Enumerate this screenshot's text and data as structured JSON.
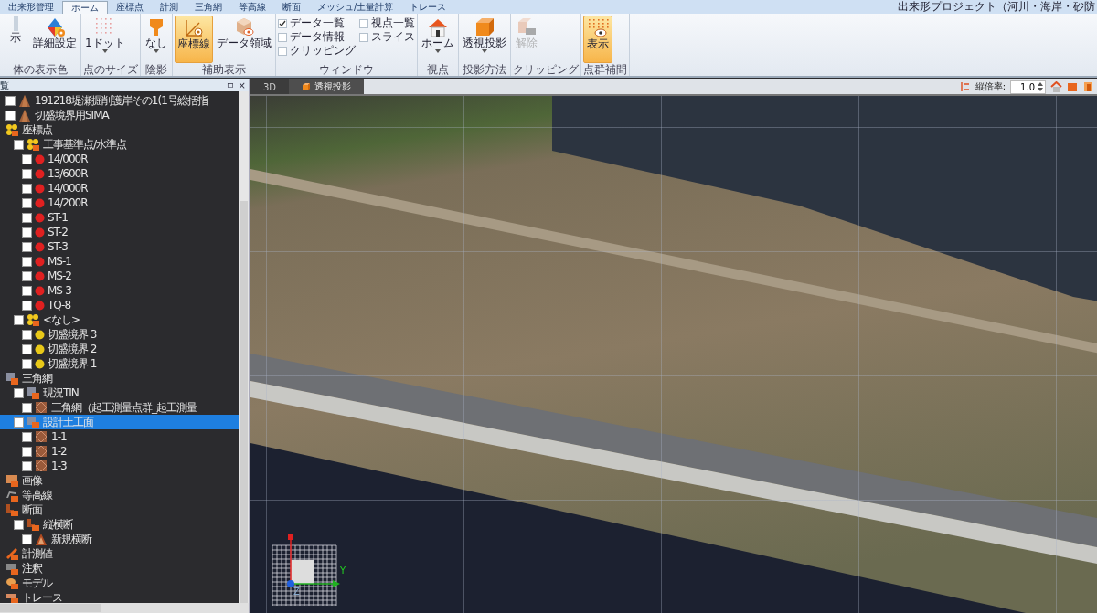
{
  "menu_tabs": [
    {
      "label": "出来形管理",
      "selected": false
    },
    {
      "label": "ホーム",
      "selected": true
    },
    {
      "label": "座標点",
      "selected": false
    },
    {
      "label": "計測",
      "selected": false
    },
    {
      "label": "三角網",
      "selected": false
    },
    {
      "label": "等高線",
      "selected": false
    },
    {
      "label": "断面",
      "selected": false
    },
    {
      "label": "メッシュ/土量計算",
      "selected": false
    },
    {
      "label": "トレース",
      "selected": false
    }
  ],
  "window": {
    "title": "出来形プロジェクト（河川・海岸・砂防"
  },
  "ribbon": [
    {
      "label": "体の表示色",
      "items": [
        {
          "kind": "display",
          "label": "示",
          "active": false,
          "disabled": false,
          "dropdown": false
        },
        {
          "kind": "settings",
          "label": "詳細設定",
          "active": false,
          "disabled": false,
          "dropdown": false
        }
      ]
    },
    {
      "label": "点のサイズ",
      "items": [
        {
          "kind": "pointsize",
          "label": "1ドット",
          "active": false,
          "disabled": false,
          "dropdown": true
        }
      ]
    },
    {
      "label": "陰影",
      "items": [
        {
          "kind": "shading",
          "label": "なし",
          "active": false,
          "disabled": false,
          "dropdown": true
        }
      ]
    },
    {
      "label": "補助表示",
      "items": [
        {
          "kind": "axes",
          "label": "座標線",
          "active": true,
          "disabled": false,
          "dropdown": false
        },
        {
          "kind": "dataarea",
          "label": "データ領域",
          "active": false,
          "disabled": false,
          "dropdown": false
        }
      ]
    },
    {
      "label": "ウィンドウ",
      "items": [
        {
          "kind": "checks",
          "checks": [
            {
              "label": "データ一覧",
              "checked": true
            },
            {
              "label": "視点一覧",
              "checked": false
            },
            {
              "label": "データ情報",
              "checked": false
            },
            {
              "label": "スライス",
              "checked": false
            },
            {
              "label": "クリッピング",
              "checked": false
            }
          ]
        }
      ]
    },
    {
      "label": "視点",
      "items": [
        {
          "kind": "home",
          "label": "ホーム",
          "active": false,
          "disabled": false,
          "dropdown": true
        }
      ]
    },
    {
      "label": "投影方法",
      "items": [
        {
          "kind": "projection",
          "label": "透視投影",
          "active": false,
          "disabled": false,
          "dropdown": true
        }
      ]
    },
    {
      "label": "クリッピング",
      "items": [
        {
          "kind": "clip",
          "label": "解除",
          "active": false,
          "disabled": true,
          "dropdown": false
        }
      ]
    },
    {
      "label": "点群補間",
      "items": [
        {
          "kind": "interpolate",
          "label": "表示",
          "active": true,
          "disabled": false,
          "dropdown": false
        }
      ]
    }
  ],
  "panel": {
    "title": "覧",
    "pin": "ㅁ",
    "close": "×"
  },
  "tree": [
    {
      "label": "191218堤瀬掘削護岸その1(1号総括指",
      "kind": "pointcloud",
      "checked": false,
      "selected": false
    },
    {
      "label": "切盛境界用SIMA",
      "kind": "pointcloud",
      "checked": false,
      "selected": false
    },
    {
      "label": "座標点",
      "kind": "points-group",
      "selected": false,
      "children": [
        {
          "label": "工事基準点/水準点",
          "kind": "points-group",
          "checked": false,
          "selected": false,
          "children": [
            {
              "label": "14/000R",
              "kind": "point",
              "color": "#e02020",
              "checked": false,
              "selected": false
            },
            {
              "label": "13/600R",
              "kind": "point",
              "color": "#e02020",
              "checked": false,
              "selected": false
            },
            {
              "label": "14/000R",
              "kind": "point",
              "color": "#e02020",
              "checked": false,
              "selected": false
            },
            {
              "label": "14/200R",
              "kind": "point",
              "color": "#e02020",
              "checked": false,
              "selected": false
            },
            {
              "label": "ST-1",
              "kind": "point",
              "color": "#e02020",
              "checked": false,
              "selected": false
            },
            {
              "label": "ST-2",
              "kind": "point",
              "color": "#e02020",
              "checked": false,
              "selected": false
            },
            {
              "label": "ST-3",
              "kind": "point",
              "color": "#e02020",
              "checked": false,
              "selected": false
            },
            {
              "label": "MS-1",
              "kind": "point",
              "color": "#e02020",
              "checked": false,
              "selected": false
            },
            {
              "label": "MS-2",
              "kind": "point",
              "color": "#e02020",
              "checked": false,
              "selected": false
            },
            {
              "label": "MS-3",
              "kind": "point",
              "color": "#e02020",
              "checked": false,
              "selected": false
            },
            {
              "label": "TQ-8",
              "kind": "point",
              "color": "#e02020",
              "checked": false,
              "selected": false
            }
          ]
        },
        {
          "label": "<なし>",
          "kind": "points-group",
          "checked": false,
          "selected": false,
          "children": [
            {
              "label": "切盛境界 3",
              "kind": "point",
              "color": "#e8c818",
              "checked": false,
              "selected": false
            },
            {
              "label": "切盛境界 2",
              "kind": "point",
              "color": "#e8c818",
              "checked": false,
              "selected": false
            },
            {
              "label": "切盛境界 1",
              "kind": "point",
              "color": "#e8c818",
              "checked": false,
              "selected": false
            }
          ]
        }
      ]
    },
    {
      "label": "三角網",
      "kind": "tin",
      "selected": false,
      "children": [
        {
          "label": "現況TIN",
          "kind": "tin",
          "checked": false,
          "selected": false,
          "children": [
            {
              "label": "三角網（起工測量点群_起工測量",
              "kind": "mesh",
              "checked": false,
              "selected": false
            }
          ]
        },
        {
          "label": "設計土工面",
          "kind": "tin",
          "checked": false,
          "selected": true,
          "children": [
            {
              "label": "1-1",
              "kind": "mesh",
              "checked": false,
              "selected": false
            },
            {
              "label": "1-2",
              "kind": "mesh",
              "checked": false,
              "selected": false
            },
            {
              "label": "1-3",
              "kind": "mesh",
              "checked": false,
              "selected": false
            }
          ]
        }
      ]
    },
    {
      "label": "画像",
      "kind": "image",
      "selected": false
    },
    {
      "label": "等高線",
      "kind": "contour",
      "selected": false
    },
    {
      "label": "断面",
      "kind": "section",
      "selected": false,
      "children": [
        {
          "label": "縦横断",
          "kind": "section",
          "checked": false,
          "selected": false,
          "children": [
            {
              "label": "新規横断",
              "kind": "cross-section",
              "checked": false,
              "selected": false
            }
          ]
        }
      ]
    },
    {
      "label": "計測値",
      "kind": "measure",
      "selected": false
    },
    {
      "label": "注釈",
      "kind": "annotation",
      "selected": false
    },
    {
      "label": "モデル",
      "kind": "model",
      "selected": false
    },
    {
      "label": "トレース",
      "kind": "trace",
      "selected": false
    }
  ],
  "view_tabs": [
    {
      "label": "3D",
      "selected": false
    },
    {
      "label": "透視投影",
      "selected": true
    }
  ],
  "view_toolbar": {
    "label": "縦倍率:",
    "value": "1.0"
  },
  "axis_widget": {
    "z_label": "Z",
    "y_label": "Y"
  }
}
